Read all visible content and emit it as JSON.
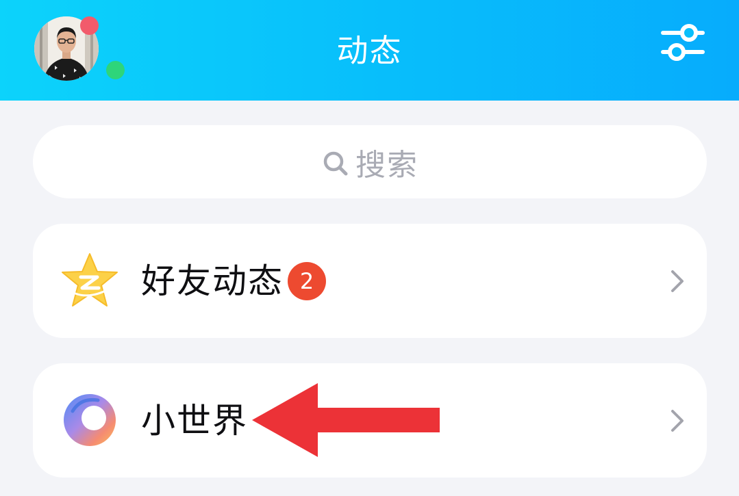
{
  "header": {
    "title": "动态",
    "avatar_alt": "avatar",
    "settings_icon": "sliders-icon",
    "colors": {
      "gradient_start": "#0cd3fb",
      "gradient_end": "#07acfc",
      "dot_red": "#f25b6b",
      "dot_green": "#2ed57a"
    }
  },
  "search": {
    "placeholder": "搜索",
    "icon": "search-icon"
  },
  "items": [
    {
      "label": "好友动态",
      "badge": "2",
      "icon": "qzone-star-icon",
      "chevron": "chevron-right-icon"
    },
    {
      "label": "小世界",
      "icon": "little-world-icon",
      "chevron": "chevron-right-icon"
    }
  ],
  "annotation": {
    "type": "arrow",
    "color": "#ec3237",
    "points_to": "小世界"
  }
}
